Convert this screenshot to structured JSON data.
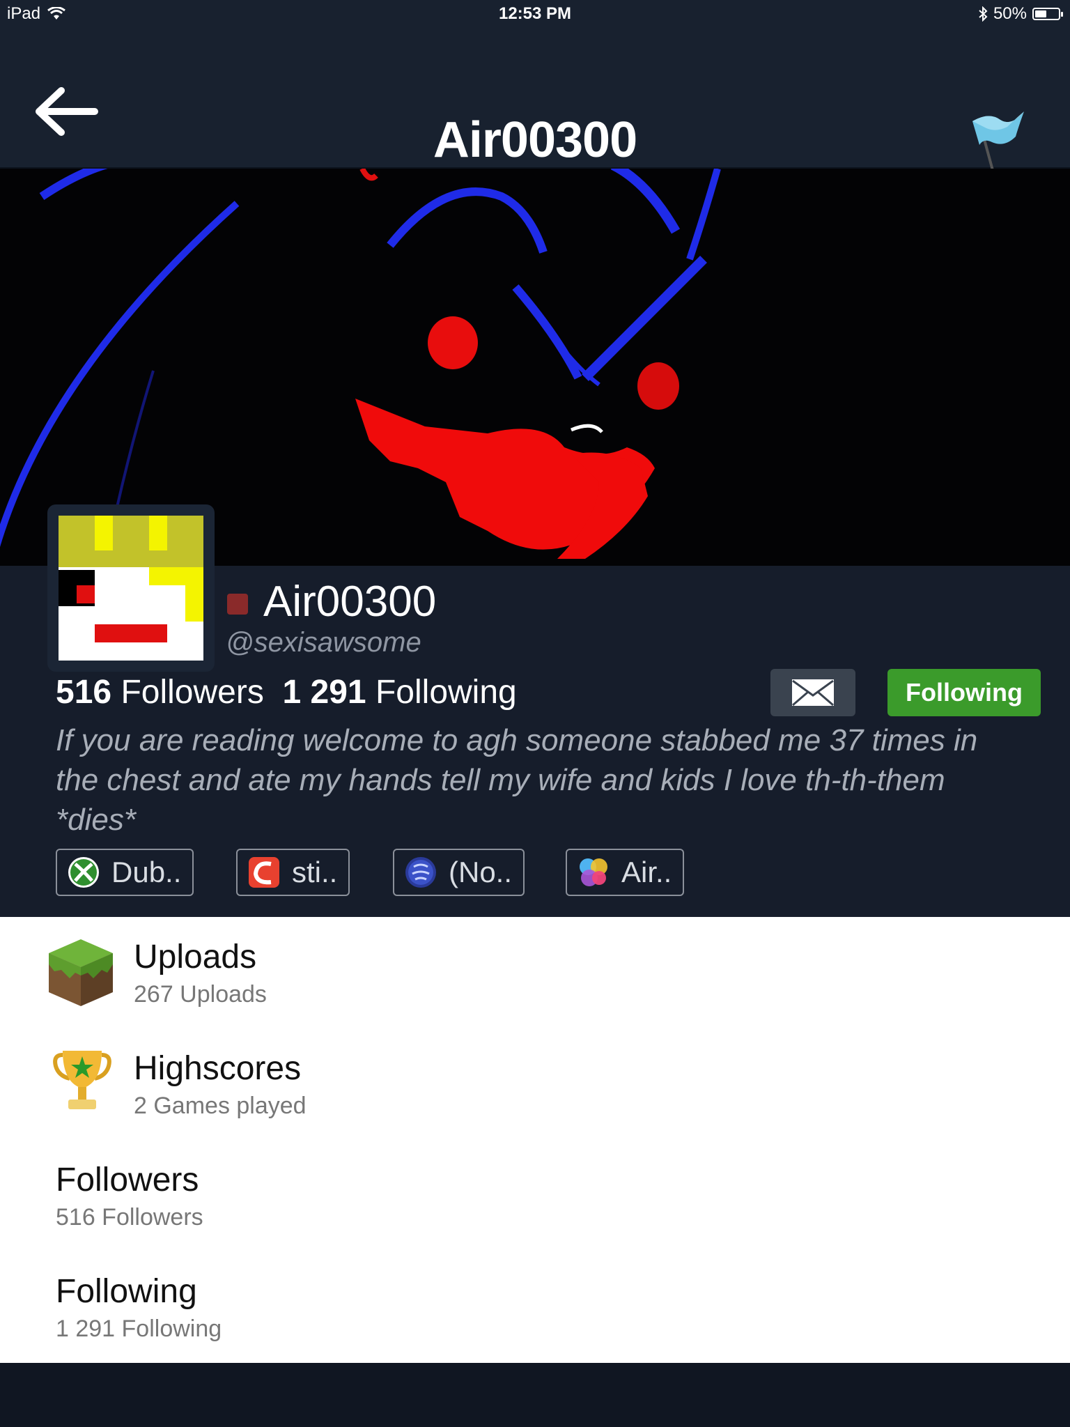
{
  "status_bar": {
    "device": "iPad",
    "time": "12:53 PM",
    "battery_percent": "50%",
    "battery_level": 0.5
  },
  "nav": {
    "title": "Air00300"
  },
  "profile": {
    "display_name": "Air00300",
    "handle": "@sexisawsome",
    "followers_count": "516",
    "followers_label": "Followers",
    "following_count": "1 291",
    "following_label": "Following",
    "follow_button_label": "Following",
    "bio": "If you are reading welcome to agh someone stabbed me 37 times in the chest and ate my hands tell my wife and kids I love th-th-them *dies*"
  },
  "platforms": [
    {
      "icon": "xbox-icon",
      "label": "Dub.."
    },
    {
      "icon": "steam-app-icon",
      "label": "sti.."
    },
    {
      "icon": "playstation-icon",
      "label": "(No.."
    },
    {
      "icon": "game-center-icon",
      "label": "Air.."
    }
  ],
  "sections": [
    {
      "icon": "minecraft-grass-block-icon",
      "title": "Uploads",
      "subtitle": "267 Uploads"
    },
    {
      "icon": "trophy-icon",
      "title": "Highscores",
      "subtitle": "2 Games played"
    },
    {
      "icon": "",
      "title": "Followers",
      "subtitle": "516 Followers"
    },
    {
      "icon": "",
      "title": "Following",
      "subtitle": "1 291 Following"
    }
  ],
  "colors": {
    "header_bg": "#18212f",
    "panel_bg": "#161d2b",
    "follow_green": "#3b9b2b",
    "offline_red": "#8a2a2a"
  }
}
